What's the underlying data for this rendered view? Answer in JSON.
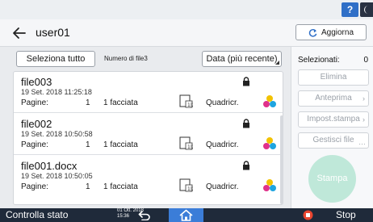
{
  "topbar": {
    "help_label": "?"
  },
  "header": {
    "title": "user01",
    "refresh_label": "Aggiorna"
  },
  "toolbar": {
    "select_all_label": "Seleziona tutto",
    "file_count_label": "Numero di file3",
    "sort_label": "Data (più recente)"
  },
  "files": [
    {
      "name": "file003",
      "date": "19 Set. 2018 11:25:18",
      "pages_label": "Pagine:",
      "pages": "1",
      "sided": "1 facciata",
      "color_mode": "Quadricr."
    },
    {
      "name": "file002",
      "date": "19 Set. 2018 10:50:58",
      "pages_label": "Pagine:",
      "pages": "1",
      "sided": "1 facciata",
      "color_mode": "Quadricr."
    },
    {
      "name": "file001.docx",
      "date": "19 Set. 2018 10:50:05",
      "pages_label": "Pagine:",
      "pages": "1",
      "sided": "1 facciata",
      "color_mode": "Quadricr."
    }
  ],
  "side_panel": {
    "selected_label": "Selezionati:",
    "selected_count": "0",
    "delete_label": "Elimina",
    "preview_label": "Anteprima",
    "print_settings_label": "Impost.stampa",
    "manage_files_label": "Gestisci file",
    "print_label": "Stampa"
  },
  "bottom_bar": {
    "status_check_label": "Controlla stato",
    "clock_date": "01 Ott. 2018",
    "clock_time": "15:36",
    "stop_label": "Stop"
  },
  "colors": {
    "accent_blue": "#3b7dd8",
    "print_button": "#bfe8d9",
    "bottom_bar": "#1f2a3a",
    "stop_red": "#e8452f"
  }
}
